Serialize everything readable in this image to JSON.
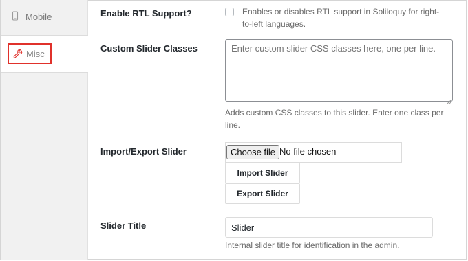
{
  "sidebar": {
    "items": [
      {
        "label": "Mobile",
        "icon": "mobile-icon",
        "active": false
      },
      {
        "label": "Misc",
        "icon": "wrench-icon",
        "active": true
      }
    ],
    "highlight_color": "#e0312b"
  },
  "settings": {
    "rtl": {
      "label": "Enable RTL Support?",
      "checked": false,
      "description": "Enables or disables RTL support in Soliloquy for right-to-left languages."
    },
    "custom_classes": {
      "label": "Custom Slider Classes",
      "value": "",
      "placeholder": "Enter custom slider CSS classes here, one per line.",
      "description": "Adds custom CSS classes to this slider. Enter one class per line."
    },
    "import_export": {
      "label": "Import/Export Slider",
      "file_button": "Choose file",
      "file_status": "No file chosen",
      "import_button": "Import Slider",
      "export_button": "Export Slider"
    },
    "slider_title": {
      "label": "Slider Title",
      "value": "Slider",
      "description": "Internal slider title for identification in the admin."
    }
  }
}
